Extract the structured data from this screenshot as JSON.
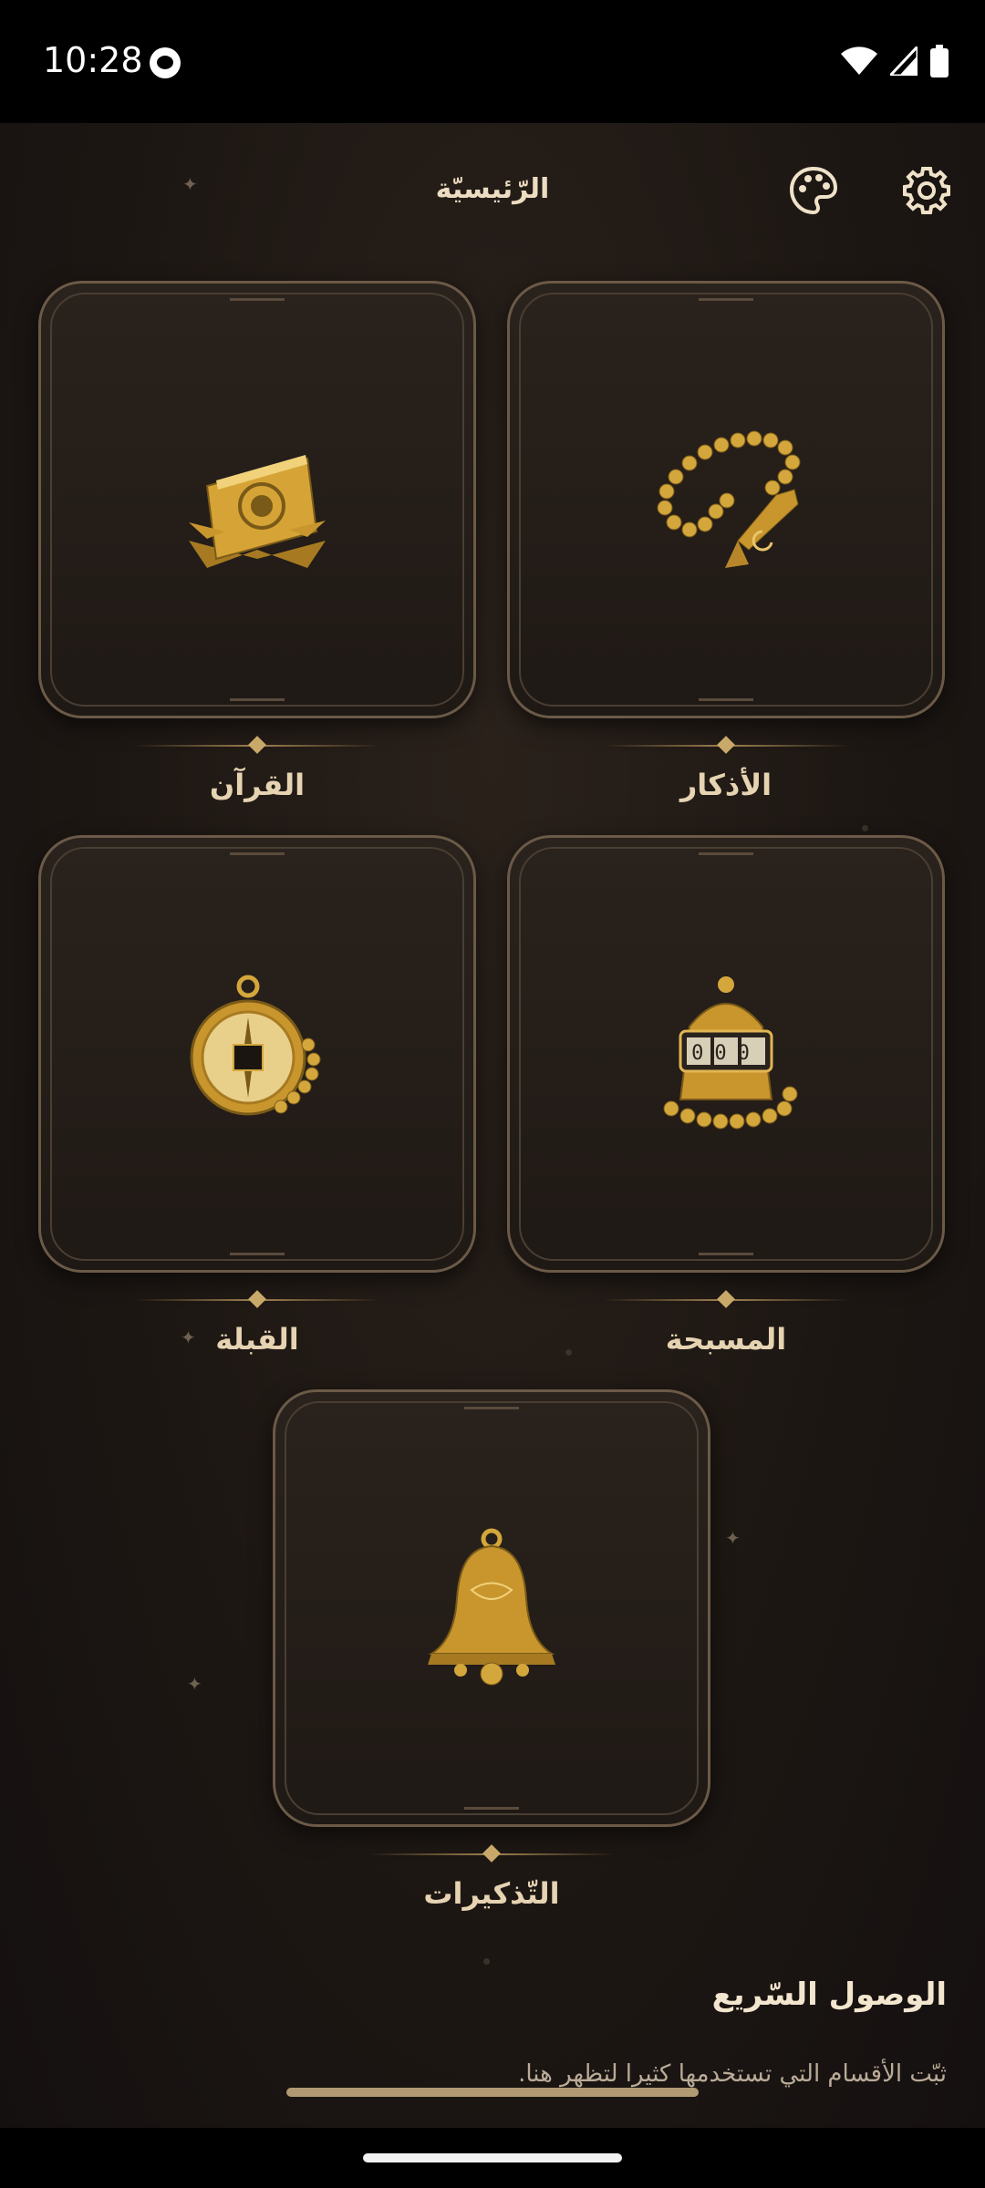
{
  "status_bar": {
    "time": "10:28"
  },
  "header": {
    "title": "الرّئيسيّة",
    "palette_icon": "palette-icon",
    "settings_icon": "gear-icon"
  },
  "tiles": [
    {
      "label": "الأذكار",
      "icon": "prayer-beads-icon"
    },
    {
      "label": "القرآن",
      "icon": "quran-book-icon"
    },
    {
      "label": "المسبحة",
      "icon": "tasbih-counter-icon",
      "counter": "000"
    },
    {
      "label": "القبلة",
      "icon": "qibla-compass-icon"
    },
    {
      "label": "التّذكيرات",
      "icon": "bell-icon"
    }
  ],
  "quick_access": {
    "title": "الوصول السّريع",
    "subtitle": "ثبّت الأقسام التي تستخدمها كثيرا لتظهر هنا."
  },
  "colors": {
    "accent_gold": "#c9a96a",
    "background": "#1c1612"
  }
}
